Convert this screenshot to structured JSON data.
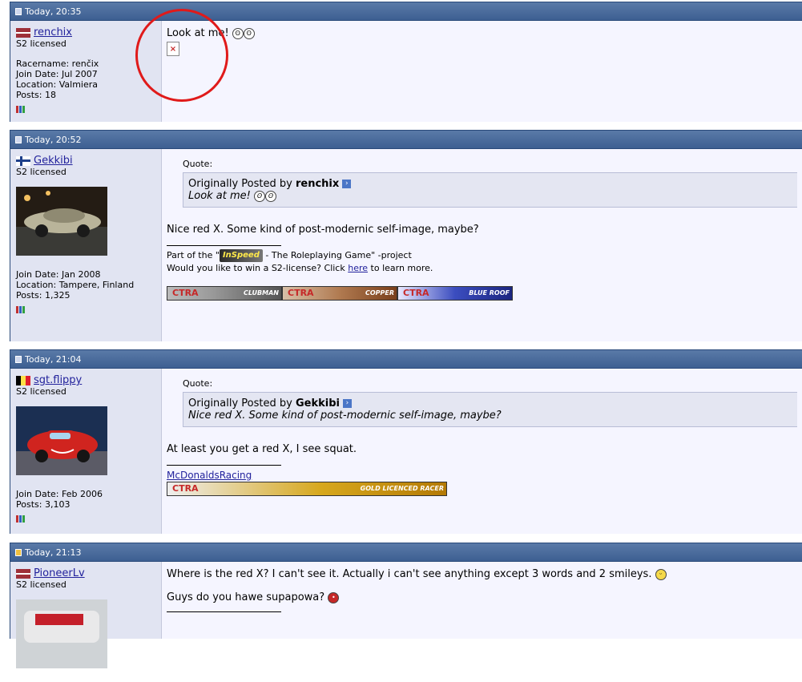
{
  "posts": [
    {
      "time": "Today, 20:35",
      "username": "renchix",
      "license": "S2 licensed",
      "racername": "Racername: renčix",
      "join": "Join Date: Jul 2007",
      "location": "Location: Valmiera",
      "posts": "Posts: 18",
      "message": "Look at me!"
    },
    {
      "time": "Today, 20:52",
      "username": "Gekkibi",
      "license": "S2 licensed",
      "join": "Join Date: Jan 2008",
      "location": "Location: Tampere, Finland",
      "posts": "Posts: 1,325",
      "quote_label": "Quote:",
      "quote_prefix": "Originally Posted by",
      "quote_author": "renchix",
      "quote_text": "Look at me!",
      "message": "Nice red X. Some kind of post-modernic self-image, maybe?",
      "sig_part_a": "Part of the \"",
      "sig_part_b": "- The Roleplaying Game\" -project",
      "sig_logo": "InSpeed",
      "sig_win_a": "Would you like to win a S2-license? Click",
      "sig_link": "here",
      "sig_win_b": "to learn more.",
      "banner1": "CLUBMAN",
      "banner2": "COPPER",
      "banner3": "BLUE ROOF"
    },
    {
      "time": "Today, 21:04",
      "username": "sgt.flippy",
      "license": "S2 licensed",
      "join": "Join Date: Feb 2006",
      "posts": "Posts: 3,103",
      "quote_label": "Quote:",
      "quote_prefix": "Originally Posted by",
      "quote_author": "Gekkibi",
      "quote_text": "Nice red X. Some kind of post-modernic self-image, maybe?",
      "message": "At least you get a red X, I see squat.",
      "sig_link": "McDonaldsRacing",
      "banner": "GOLD LICENCED RACER"
    },
    {
      "time": "Today, 21:13",
      "username": "PioneerLv",
      "license": "S2 licensed",
      "message1": "Where is the red X? I can't see it. Actually i can't see anything except 3 words and 2 smileys.",
      "message2": "Guys do you hawe supapowa?"
    }
  ],
  "colors": {
    "header": "#3d5f92",
    "userinfo_bg": "#e1e4f2",
    "content_bg": "#f5f5ff",
    "link": "#22229c",
    "annotation": "#e01a1a"
  },
  "icons": [
    "post-icon",
    "flag-icon",
    "rank-icon",
    "smiley-icon",
    "view-post-icon",
    "broken-image-icon"
  ]
}
